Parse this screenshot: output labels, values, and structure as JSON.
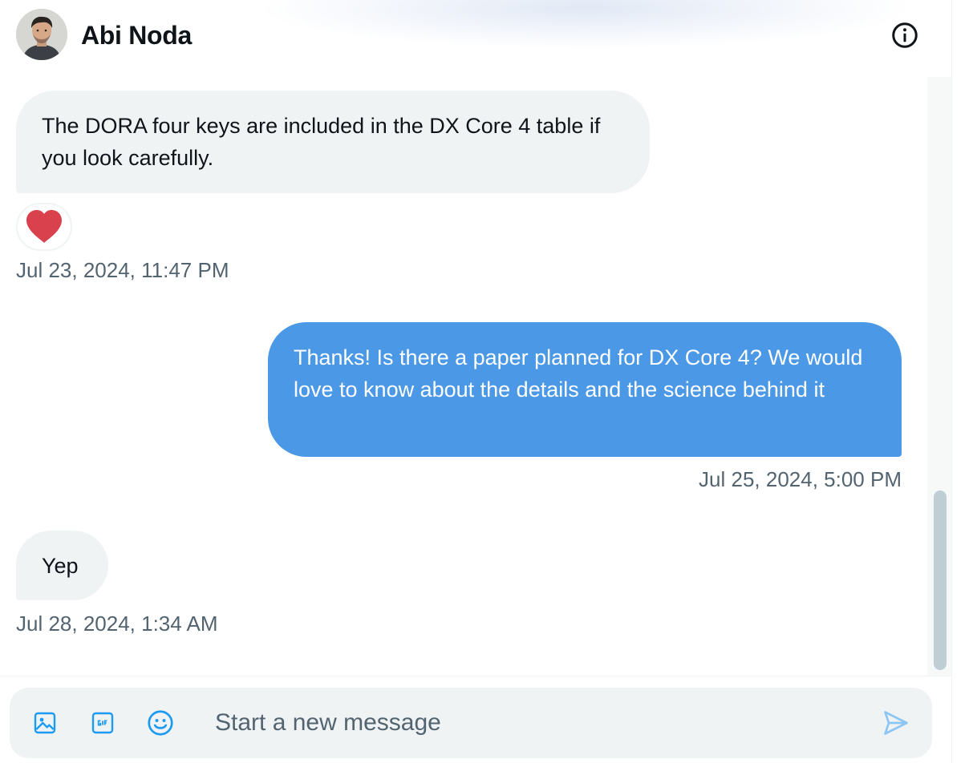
{
  "header": {
    "contact_name": "Abi Noda",
    "avatar_icon": "user-avatar-photo",
    "info_icon": "info-icon"
  },
  "messages": [
    {
      "direction": "incoming",
      "text": "The DORA four keys are included in the DX Core 4 table if you look carefully.",
      "reaction": "red-heart",
      "timestamp": "Jul 23, 2024, 11:47 PM"
    },
    {
      "direction": "outgoing",
      "text": "Thanks! Is there a paper planned for DX Core 4? We would love to know about the details and the science behind it",
      "timestamp": "Jul 25, 2024, 5:00 PM"
    },
    {
      "direction": "incoming",
      "text": "Yep",
      "timestamp": "Jul 28, 2024, 1:34 AM"
    }
  ],
  "composer": {
    "placeholder": "Start a new message",
    "tools": [
      "image-icon",
      "gif-icon",
      "emoji-icon"
    ],
    "send_icon": "send-icon"
  },
  "colors": {
    "accent": "#1d9bf0",
    "outgoing_bubble": "#4a98e6",
    "incoming_bubble": "#eff3f4",
    "secondary_text": "#536471",
    "heart": "#d9414d"
  }
}
